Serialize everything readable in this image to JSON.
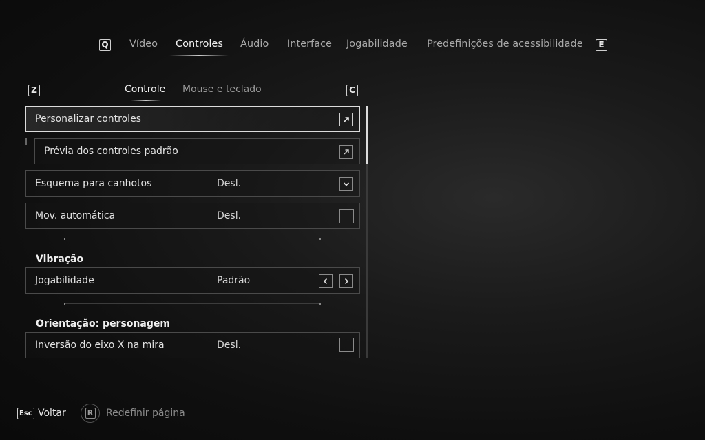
{
  "top_nav": {
    "prev_key": "Q",
    "next_key": "E",
    "tabs": [
      {
        "label": "Vídeo"
      },
      {
        "label": "Controles"
      },
      {
        "label": "Áudio"
      },
      {
        "label": "Interface"
      },
      {
        "label": "Jogabilidade"
      },
      {
        "label": "Predefinições de acessibilidade"
      }
    ],
    "active_tab": "Controles"
  },
  "sub_nav": {
    "prev_key": "Z",
    "next_key": "C",
    "tabs": [
      {
        "label": "Controle"
      },
      {
        "label": "Mouse e teclado"
      }
    ],
    "active_tab": "Controle"
  },
  "settings": {
    "customize": {
      "label": "Personalizar controles",
      "icon": "external-arrow-icon"
    },
    "preview": {
      "label": "Prévia dos controles padrão",
      "icon": "external-arrow-icon"
    },
    "left_handed": {
      "label": "Esquema para canhotos",
      "value": "Desl.",
      "icon": "chevron-down-icon"
    },
    "auto_move": {
      "label": "Mov. automática",
      "value": "Desl.",
      "icon": "checkbox-icon"
    },
    "vibration_header": "Vibração",
    "vibration_gameplay": {
      "label": "Jogabilidade",
      "value": "Padrão"
    },
    "orientation_header": "Orientação: personagem",
    "invert_x": {
      "label": "Inversão do eixo X na mira",
      "value": "Desl.",
      "icon": "checkbox-icon"
    }
  },
  "footer": {
    "back_key": "Esc",
    "back_label": "Voltar",
    "reset_key": "R",
    "reset_label": "Redefinir página"
  },
  "colors": {
    "background": "#121212",
    "text_active": "#f2f2f2",
    "text_inactive": "#a9a9a9",
    "row_border": "#4a4a4a",
    "selected_border": "#dcdcdc"
  }
}
